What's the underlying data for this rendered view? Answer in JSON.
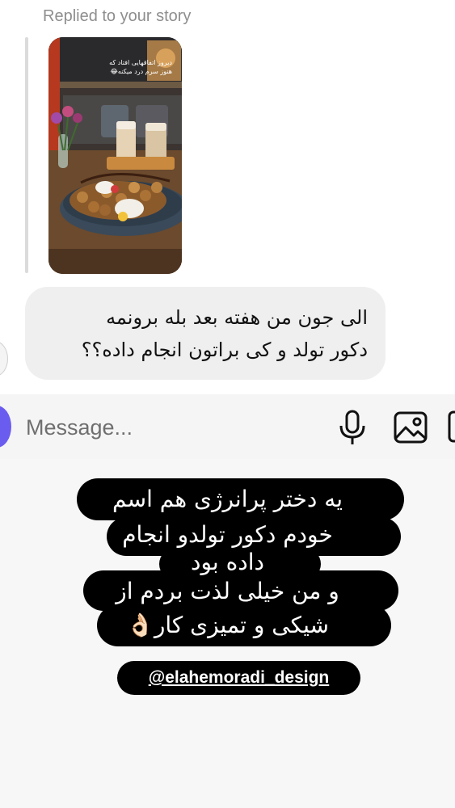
{
  "reply": {
    "replied_label": "Replied to your story",
    "story_caption": "دیروز اتفاقهایی افتاد که هنوز سرم درد میکنه😂"
  },
  "message": {
    "line1": "الی جون من هفته بعد بله برونمه",
    "line2": "دکور تولد و کی براتون انجام داده؟؟"
  },
  "composer": {
    "placeholder": "Message...",
    "icons": [
      "camera-icon",
      "microphone-icon",
      "gallery-icon"
    ]
  },
  "caption": {
    "line1": "یه دختر پرانرژی هم اسم",
    "line2": "خودم دکور تولدو انجام",
    "line3": "داده بود",
    "line4": "و من خیلی لذت بردم از",
    "line5": "شیکی و تمیزی کار👌🏻"
  },
  "handle": "@elahemoradi_design",
  "colors": {
    "bubble": "#efefef",
    "composer": "#f5f5f5",
    "camera_button": "#6b5cf0",
    "caption_bg": "#000000",
    "caption_text": "#ffffff"
  }
}
